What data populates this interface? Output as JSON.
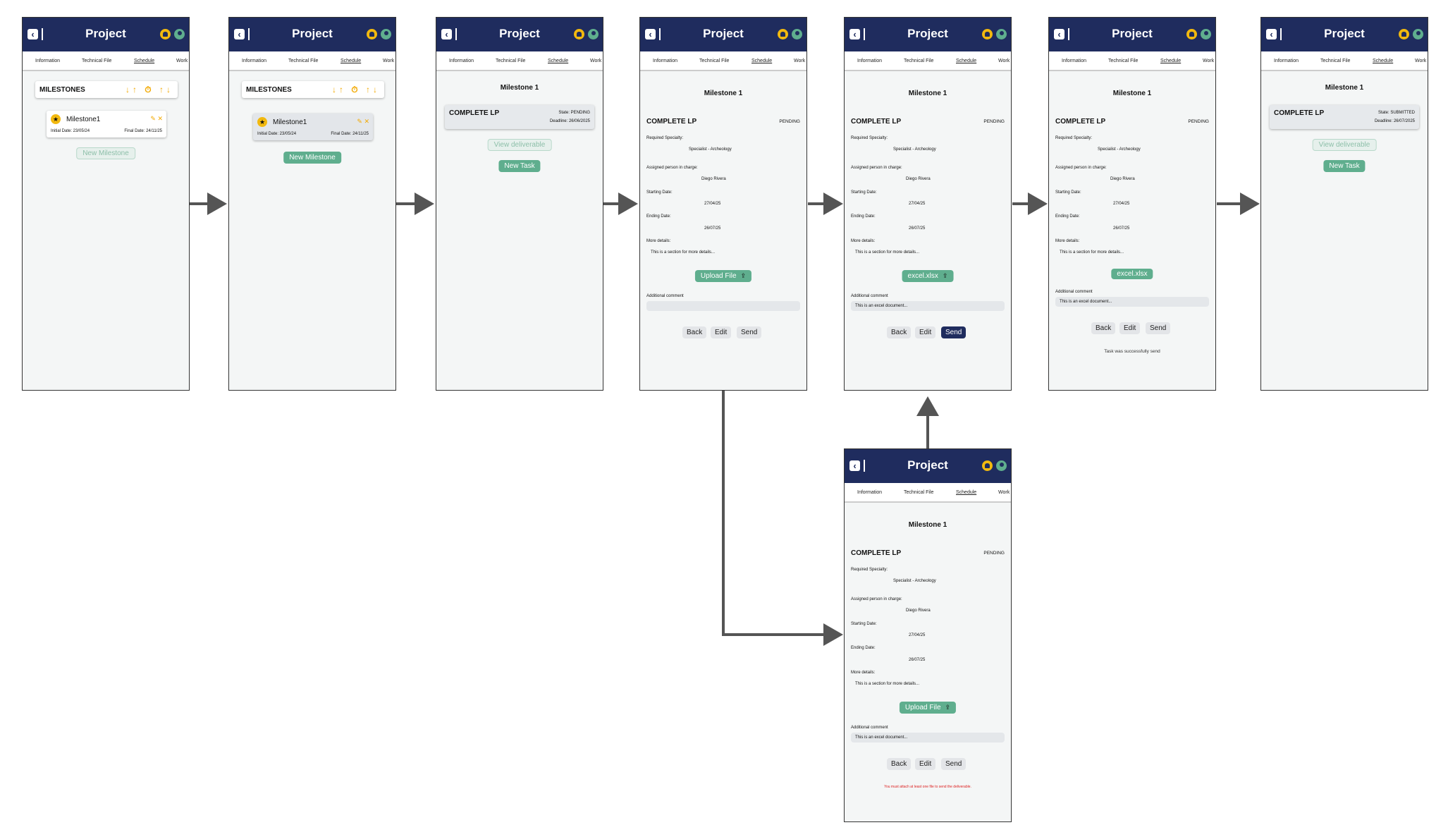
{
  "app": {
    "title": "Project",
    "back_icon": "back-icon",
    "bell_icon": "bell-icon",
    "user_icon": "user-icon",
    "colors": {
      "navy": "#1f2c5e",
      "accent_yellow": "#f2b90f",
      "accent_green": "#5fae8e",
      "error_red": "#d22222"
    }
  },
  "tabs": {
    "information": "Information",
    "technical_file": "Technical File",
    "schedule": "Schedule",
    "work": "Work"
  },
  "milestones": {
    "header": "MILESTONES",
    "header_icons": "↓↑ ⏱ ↑↓",
    "name": "Milestone1",
    "edit_icon": "✎",
    "delete_icon": "✕",
    "initial_date": "Initial Date: 23/05/24",
    "final_date": "Final Date: 24/11/25",
    "new_button": "New Milestone"
  },
  "milestone_view": {
    "title": "Milestone 1",
    "task_name": "COMPLETE LP",
    "state_pending": "State: PENDING",
    "state_submitted": "State: SUBMITTED",
    "deadline_pending": "Deadline: 26/06/2025",
    "deadline_submitted": "Deadline: 26/07/2025",
    "view_deliverable": "View deliverable",
    "new_task": "New Task"
  },
  "task_detail": {
    "title": "Milestone 1",
    "task_name": "COMPLETE LP",
    "state": "PENDING",
    "required_specialty_label": "Required Specialty:",
    "required_specialty": "Specialist - Archeology",
    "assigned_label": "Assigned person in charge:",
    "assigned": "Diego Rivera",
    "start_label": "Starting Date:",
    "start": "27/04/25",
    "end_label": "Ending Date:",
    "end": "26/07/25",
    "more_label": "More details:",
    "more": "This is a section for more details...",
    "upload": "Upload File",
    "upload_icon": "⇪",
    "file": "excel.xlsx",
    "comment_label": "Additional comment",
    "comment_value": "This is an excel document...",
    "back": "Back",
    "edit": "Edit",
    "send": "Send",
    "success": "Task was successfully send",
    "error": "You must attach at least one file to send the deliverable."
  }
}
